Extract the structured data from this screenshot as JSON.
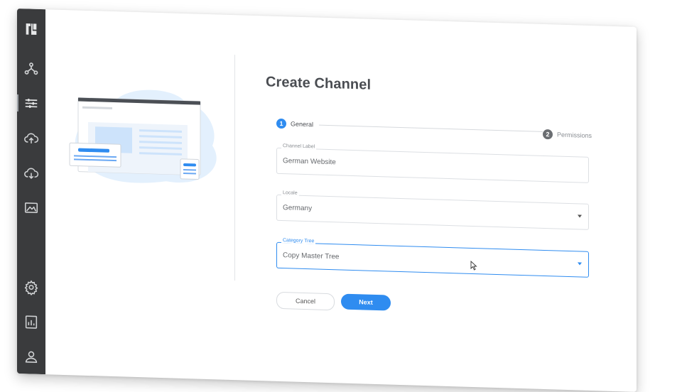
{
  "colors": {
    "sidebar": "#3a3b3d",
    "accent": "#2f8cf0",
    "inactive_step": "#6b6e72"
  },
  "sidebar": {
    "items": [
      {
        "icon": "logo-icon"
      },
      {
        "icon": "network-icon"
      },
      {
        "icon": "sliders-icon",
        "active": true
      },
      {
        "icon": "cloud-upload-icon"
      },
      {
        "icon": "cloud-download-icon"
      },
      {
        "icon": "image-icon"
      },
      {
        "icon": "gear-icon"
      },
      {
        "icon": "report-icon"
      },
      {
        "icon": "user-icon"
      }
    ]
  },
  "page": {
    "title": "Create Channel"
  },
  "stepper": {
    "steps": [
      {
        "number": "1",
        "label": "General",
        "active": true
      },
      {
        "number": "2",
        "label": "Permissions",
        "active": false
      }
    ]
  },
  "form": {
    "channel_label": {
      "label": "Channel Label",
      "value": "German Website"
    },
    "locale": {
      "label": "Locale",
      "value": "Germany"
    },
    "category_tree": {
      "label": "Category Tree",
      "value": "Copy Master Tree"
    }
  },
  "buttons": {
    "cancel": "Cancel",
    "next": "Next"
  }
}
